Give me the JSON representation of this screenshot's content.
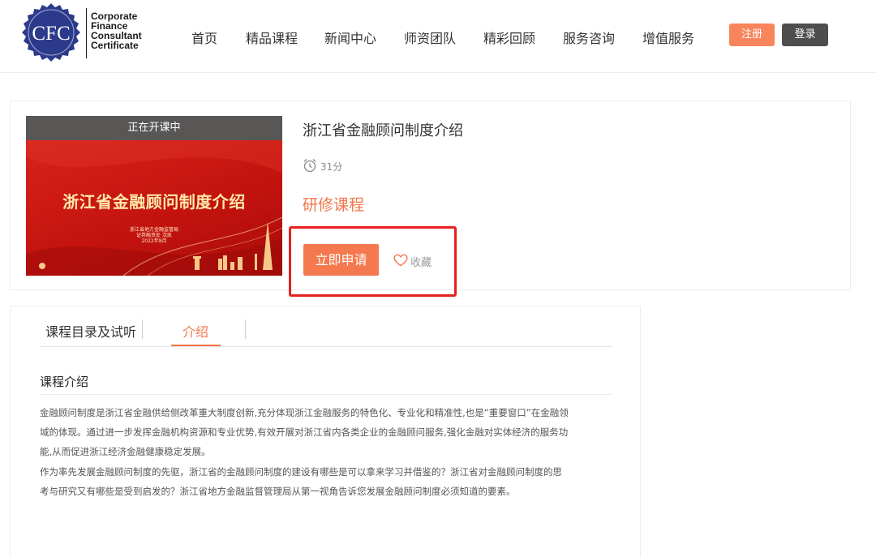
{
  "logo": {
    "seal_text": "CFC",
    "words": [
      "Corporate",
      "Finance",
      "Consultant",
      "Certificate"
    ]
  },
  "nav": {
    "items": [
      "首页",
      "精品课程",
      "新闻中心",
      "师资团队",
      "精彩回顾",
      "服务咨询",
      "增值服务"
    ]
  },
  "auth": {
    "register": "注册",
    "login": "登录"
  },
  "course": {
    "status_banner": "正在开课中",
    "thumb_title": "浙江省金融顾问制度介绍",
    "thumb_lines": [
      "浙江省地方金融监管局",
      "证券融资处  沈凯",
      "2022年8月"
    ],
    "title": "浙江省金融顾问制度介绍",
    "duration": "31分",
    "type": "研修课程",
    "apply_label": "立即申请",
    "fav_label": "收藏"
  },
  "tabs": {
    "items": [
      "课程目录及试听",
      "介绍"
    ],
    "active_index": 1
  },
  "intro": {
    "heading": "课程介绍",
    "lines": [
      "金融顾问制度是浙江省金融供给侧改革重大制度创新,充分体现浙江金融服务的特色化、专业化和精准性,也是“重要窗口”在金融领",
      "域的体现。通过进一步发挥金融机构资源和专业优势,有效开展对浙江省内各类企业的金融顾问服务,强化金融对实体经济的服务功",
      "能,从而促进浙江经济金融健康稳定发展。",
      "作为率先发展金融顾问制度的先驱，浙江省的金融顾问制度的建设有哪些是可以拿来学习并借鉴的？浙江省对金融顾问制度的思",
      "考与研究又有哪些是受到启发的？浙江省地方金融监督管理局从第一视角告诉您发展金融顾问制度必须知道的要素。"
    ]
  },
  "colors": {
    "accent": "#f4764a",
    "highlight_border": "#e8201e",
    "logo_blue": "#2c3a8c",
    "login_bg": "#4e4e4e"
  }
}
